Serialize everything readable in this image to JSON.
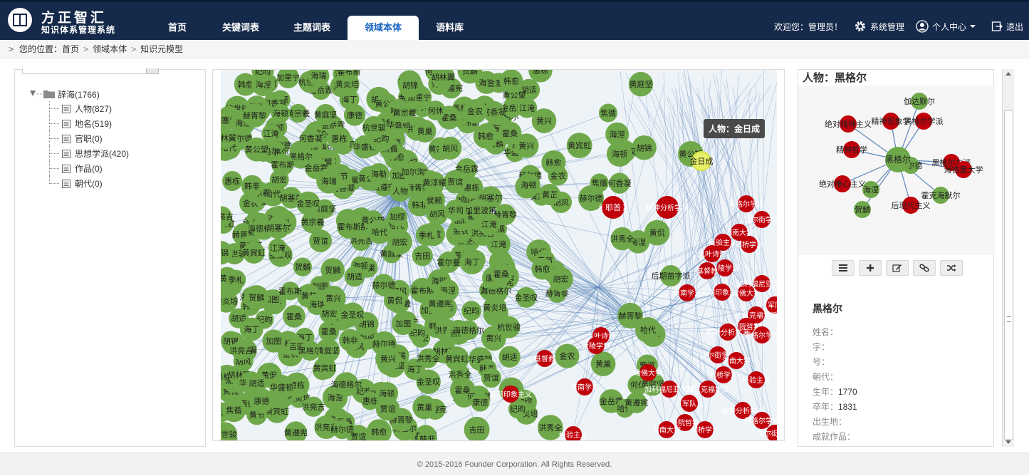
{
  "brand": {
    "name": "方正智汇",
    "subtitle": "知识体系管理系统"
  },
  "nav": {
    "tabs": [
      "首页",
      "关键词表",
      "主题词表",
      "领域本体",
      "语料库"
    ],
    "active": 3
  },
  "user": {
    "welcome": "欢迎您：管理员！",
    "settings": "系统管理",
    "profile": "个人中心",
    "logout": "退出"
  },
  "breadcrumb": {
    "prefix": "您的位置：",
    "items": [
      "首页",
      "领域本体",
      "知识元模型"
    ]
  },
  "tree": {
    "root": "辞海(1766)",
    "items": [
      "人物(827)",
      "地名(519)",
      "官职(0)",
      "思想学派(420)",
      "作品(0)",
      "朝代(0)"
    ]
  },
  "graph": {
    "tooltip": "人物：金日成",
    "center_label": "人物",
    "hub_labels": [
      "加尔洵",
      "海勒",
      "黄淳耀",
      "侯赖",
      "霍尔曼",
      "黄芷",
      "加里波第",
      "华司",
      "耶普",
      "后期苗字派"
    ],
    "green_label_pool": [
      "海涅",
      "黄宗羲",
      "胡适",
      "华盛顿",
      "黑格尔",
      "加图",
      "黄巢",
      "海丁",
      "黄兴",
      "胡塞尔",
      "霍布斯",
      "金岳霖",
      "江淹",
      "洪秀全",
      "韩非",
      "黄庭坚",
      "何香凝",
      "海德格尔",
      "胡锦",
      "加缪",
      "黄炎培",
      "韩愈",
      "洪亮吉",
      "纪昀",
      "贾谊",
      "金圣叹",
      "霍桑",
      "胡林翼",
      "惠栋",
      "黄遵宪",
      "哈代",
      "赫胥黎",
      "海顿",
      "黄公望",
      "赫尔德",
      "康德",
      "黄节",
      "何休",
      "吉田",
      "杭世骏",
      "黄宾虹",
      "加里宁",
      "海瑞",
      "黄侃",
      "胡风",
      "贺麟",
      "胡宏",
      "季札",
      "焦循",
      "金农"
    ],
    "red_label_pool": [
      "经院哲学",
      "精神分析学派",
      "黑格尔学派",
      "华尔街学派",
      "湖南大学",
      "剑桥学派",
      "经验主义",
      "九叶诗派",
      "金陵学派",
      "基督教",
      "华南学派",
      "后期印象主义",
      "哈佛大学",
      "加利福尼亚大学",
      "军队",
      "法兰克福学派"
    ]
  },
  "detail": {
    "title": "人物：黑格尔",
    "mini_graph": {
      "center": "黑格尔",
      "nodes": [
        {
          "label": "伽达默尔",
          "kind": "green"
        },
        {
          "label": "绝对精神主义",
          "kind": "red"
        },
        {
          "label": "精神现象学",
          "kind": "red"
        },
        {
          "label": "黑格尔学派",
          "kind": "red"
        },
        {
          "label": "精神哲学",
          "kind": "red"
        },
        {
          "label": "黑格尔左派",
          "kind": "red"
        },
        {
          "label": "海德堡大学",
          "kind": "red"
        },
        {
          "label": "赫尔德",
          "kind": "green"
        },
        {
          "label": "绝对唯心主义",
          "kind": "red"
        },
        {
          "label": "海涅",
          "kind": "green"
        },
        {
          "label": "贺麟",
          "kind": "green"
        },
        {
          "label": "后现代主义",
          "kind": "red"
        },
        {
          "label": "霍克海默尔",
          "kind": "green"
        }
      ]
    },
    "toolbar": [
      "list-icon",
      "plus-icon",
      "edit-icon",
      "link-icon",
      "shuffle-icon"
    ],
    "name": "黑格尔",
    "fields": [
      {
        "label": "姓名：",
        "value": ""
      },
      {
        "label": "字：",
        "value": ""
      },
      {
        "label": "号：",
        "value": ""
      },
      {
        "label": "朝代：",
        "value": ""
      },
      {
        "label": "生年：",
        "value": "1770"
      },
      {
        "label": "卒年：",
        "value": "1831"
      },
      {
        "label": "出生地：",
        "value": ""
      },
      {
        "label": "成就作品：",
        "value": ""
      }
    ]
  },
  "colors": {
    "header_bg": "#15294a",
    "active_tab": "#1a66c2",
    "node_green": "#6fa84a",
    "node_red": "#c0000a",
    "edge_blue": "#5b86b8",
    "highlight": "#e8f06a"
  },
  "footer": "© 2015-2016 Founder Corporation. All Rights Reserved."
}
